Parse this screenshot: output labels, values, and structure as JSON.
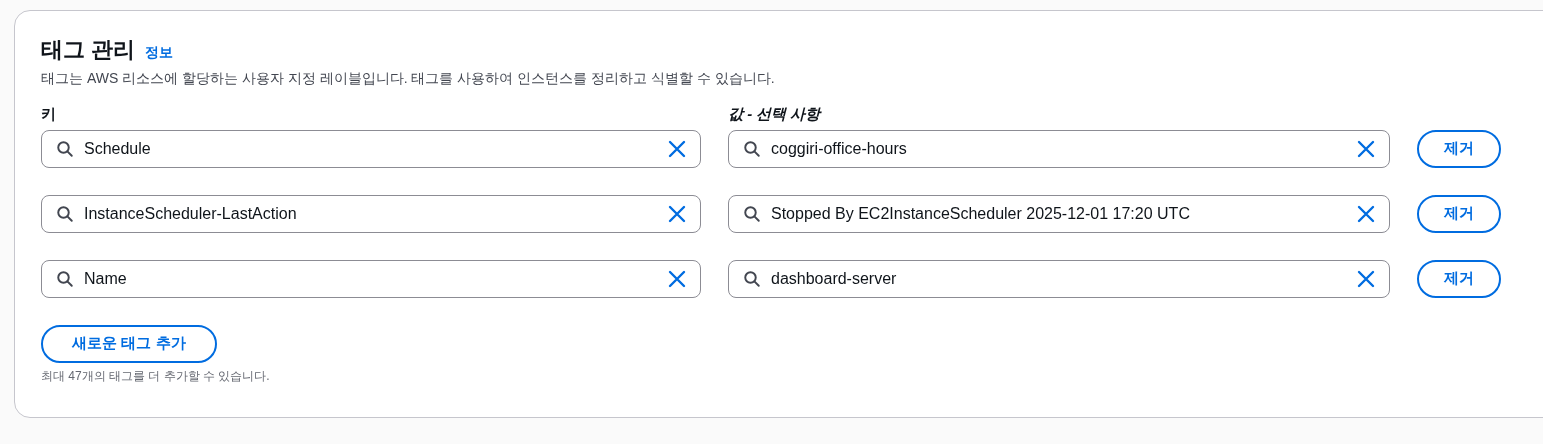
{
  "header": {
    "title": "태그 관리",
    "info_link": "정보",
    "description": "태그는 AWS 리소스에 할당하는 사용자 지정 레이블입니다. 태그를 사용하여 인스턴스를 정리하고 식별할 수 있습니다."
  },
  "columns": {
    "key": "키",
    "value": "값 - 선택 사항"
  },
  "tags": [
    {
      "key": "Schedule",
      "value": "coggiri-office-hours",
      "remove": "제거"
    },
    {
      "key": "InstanceScheduler-LastAction",
      "value": "Stopped By EC2InstanceScheduler 2025-12-01 17:20 UTC",
      "remove": "제거"
    },
    {
      "key": "Name",
      "value": "dashboard-server",
      "remove": "제거"
    }
  ],
  "add_button": "새로운 태그 추가",
  "hint": "최대 47개의 태그를 더 추가할 수 있습니다."
}
